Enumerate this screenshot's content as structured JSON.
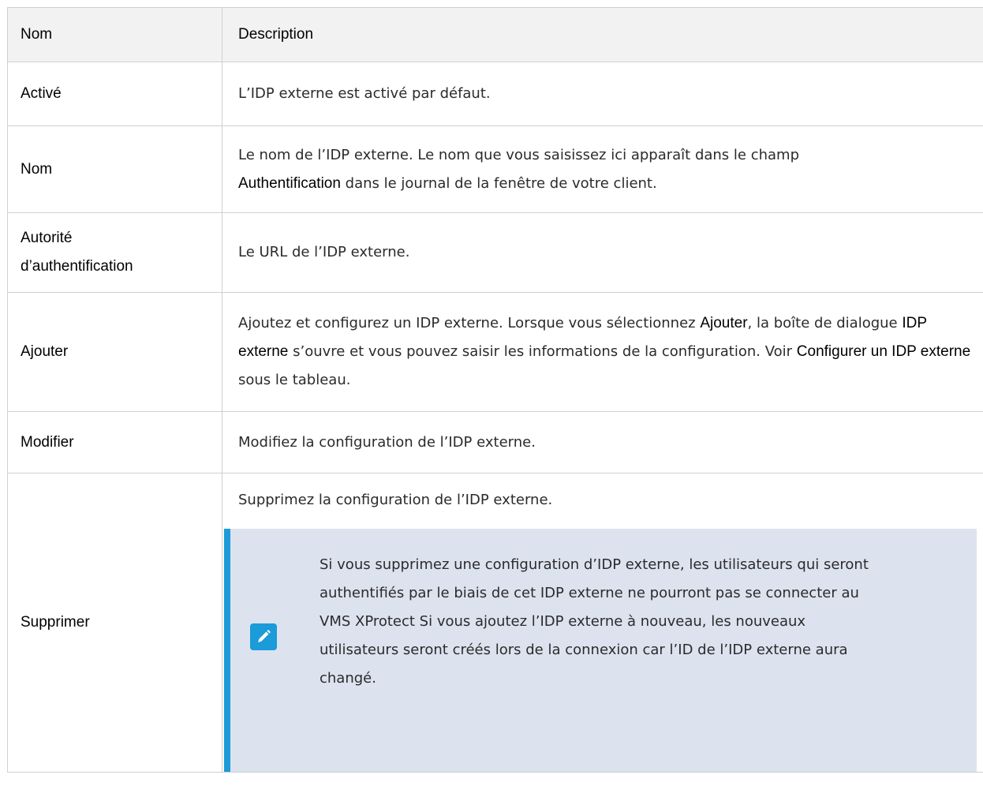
{
  "table": {
    "headers": {
      "name": "Nom",
      "description": "Description"
    },
    "rows": [
      {
        "name": "Activé",
        "description": "L’IDP externe est activé par défaut."
      },
      {
        "name": "Nom",
        "description_parts": [
          "Le nom de l’IDP externe. Le nom que vous saisissez ici apparaît dans le champ ",
          "Authentification",
          " dans le journal de la fenêtre de votre client."
        ]
      },
      {
        "name_line1": "Autorité",
        "name_line2": "d’authentification",
        "description": "Le URL de l’IDP externe."
      },
      {
        "name": "Ajouter",
        "description_parts": [
          "Ajoutez et configurez un IDP externe. Lorsque vous sélectionnez ",
          "Ajouter",
          ", la boîte de dialogue ",
          "IDP externe",
          " s’ouvre et vous pouvez saisir les informations de la configuration. Voir ",
          "Configurer un IDP externe",
          " sous le tableau."
        ]
      },
      {
        "name": "Modifier",
        "description": "Modifiez la configuration de l’IDP externe."
      },
      {
        "name": "Supprimer",
        "description": "Supprimez la configuration de l’IDP externe.",
        "note": {
          "icon": "pencil-icon",
          "text": "Si vous supprimez une configuration d’IDP externe, les utilisateurs qui seront authentifiés par le biais de cet IDP externe ne pourront pas se connecter au VMS XProtect Si vous ajoutez l’IDP externe à nouveau, les nouveaux utilisateurs seront créés lors de la connexion car l’ID de l’IDP externe aura changé."
        }
      }
    ]
  },
  "colors": {
    "header_bg": "#f2f2f2",
    "border": "#d0d0d0",
    "note_bg": "#dce3ef",
    "note_accent": "#1b9bd7"
  }
}
